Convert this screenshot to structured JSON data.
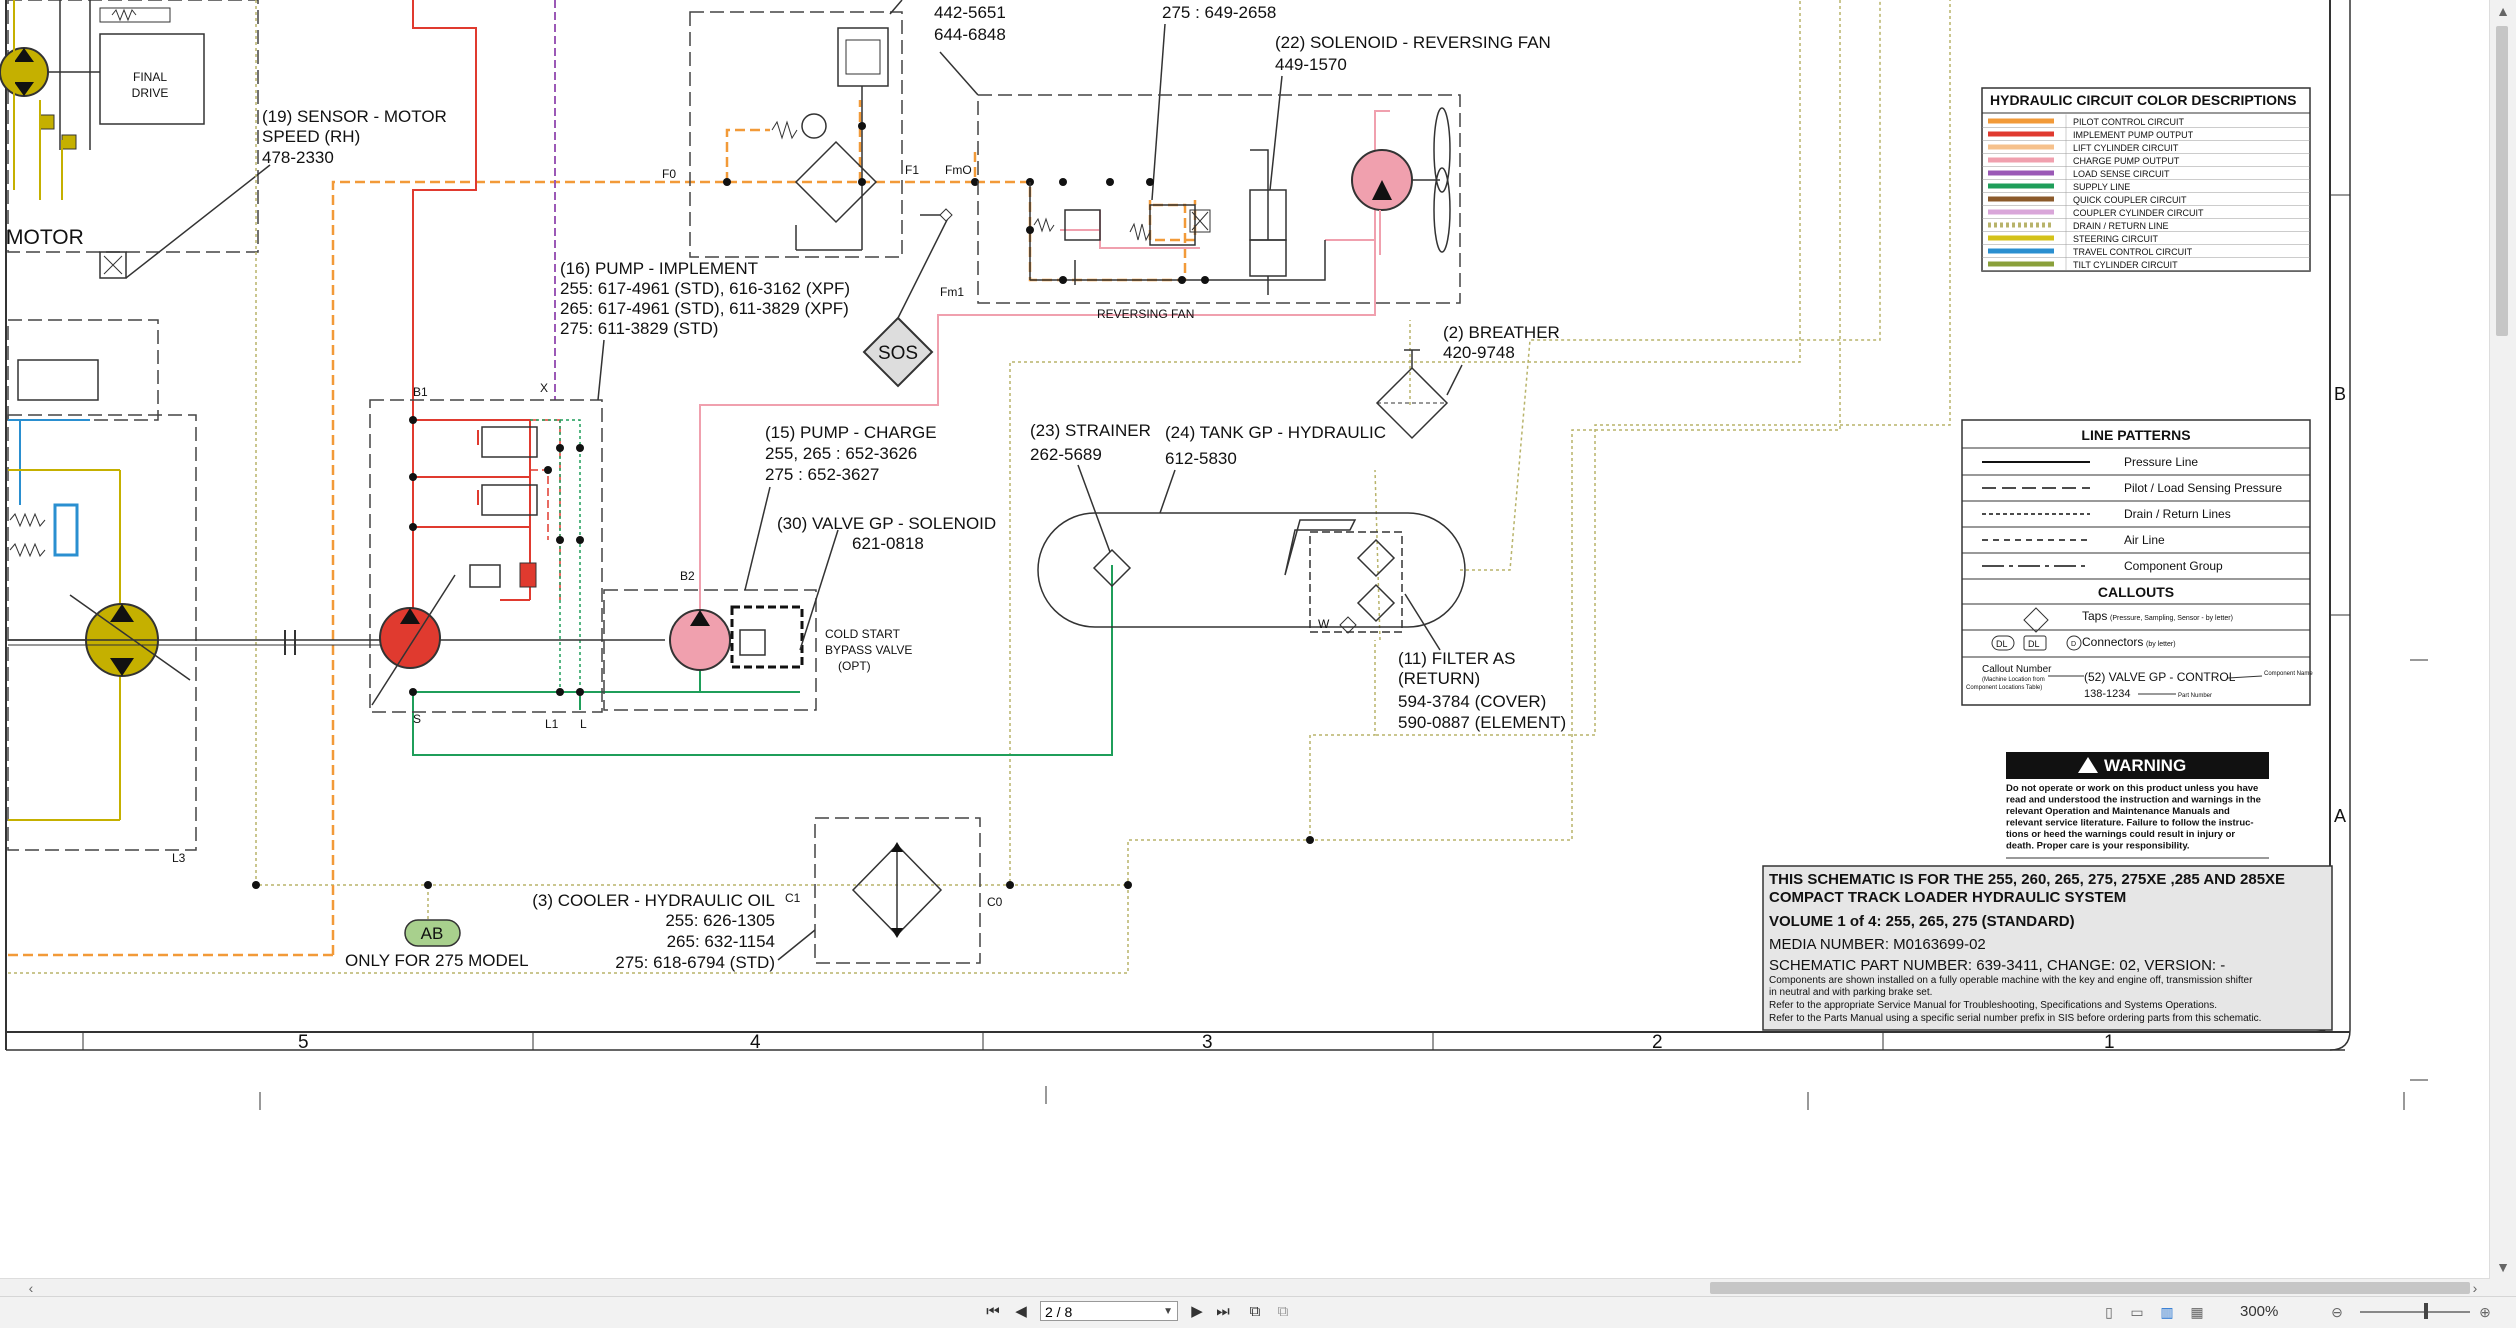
{
  "viewer": {
    "page_value": "2 / 8",
    "zoom": "300%"
  },
  "schematic": {
    "title_block": {
      "line1": "THIS SCHEMATIC IS FOR THE 255, 260, 265, 275, 275XE ,285 AND 285XE",
      "line2": "COMPACT TRACK LOADER HYDRAULIC SYSTEM",
      "volume": "VOLUME 1 of 4: 255, 265, 275 (STANDARD)",
      "media": "MEDIA NUMBER: M0163699-02",
      "part": "SCHEMATIC PART NUMBER: 639-3411, CHANGE: 02, VERSION: -",
      "note1": "Components are shown installed on a fully operable machine with the key and engine off, transmission shifter",
      "note2": "in neutral and with parking brake set.",
      "note3": "Refer to the appropriate Service Manual for Troubleshooting, Specifications and Systems Operations.",
      "note4": "Refer to the Parts Manual using a specific serial number prefix in SIS before ordering parts from this schematic."
    },
    "warning": {
      "title": "WARNING",
      "lines": [
        "Do not operate or work on this product unless you have",
        "read and understood the instruction and warnings in the",
        "relevant Operation and Maintenance Manuals and",
        "relevant service literature. Failure to follow the instruc-",
        "tions or heed the warnings could result in injury or",
        "death. Proper care is your responsibility."
      ]
    },
    "color_legend": {
      "title": "HYDRAULIC CIRCUIT COLOR DESCRIPTIONS",
      "items": [
        {
          "label": "PILOT CONTROL CIRCUIT",
          "color": "#f29a38",
          "pattern": "solid"
        },
        {
          "label": "IMPLEMENT PUMP OUTPUT",
          "color": "#e03a2f",
          "pattern": "solid"
        },
        {
          "label": "LIFT CYLINDER CIRCUIT",
          "color": "#f6c18c",
          "pattern": "solid"
        },
        {
          "label": "CHARGE PUMP OUTPUT",
          "color": "#f0a0ae",
          "pattern": "solid"
        },
        {
          "label": "LOAD SENSE CIRCUIT",
          "color": "#9b59b6",
          "pattern": "solid"
        },
        {
          "label": "SUPPLY LINE",
          "color": "#1f9e5a",
          "pattern": "solid"
        },
        {
          "label": "QUICK COUPLER CIRCUIT",
          "color": "#8b5a2b",
          "pattern": "solid"
        },
        {
          "label": "COUPLER CYLINDER CIRCUIT",
          "color": "#d9a6d9",
          "pattern": "solid"
        },
        {
          "label": "DRAIN / RETURN LINE",
          "color": "#b8b36a",
          "pattern": "dotted"
        },
        {
          "label": "STEERING CIRCUIT",
          "color": "#d4c21a",
          "pattern": "solid"
        },
        {
          "label": "TRAVEL CONTROL CIRCUIT",
          "color": "#2a8fd0",
          "pattern": "solid"
        },
        {
          "label": "TILT CYLINDER CIRCUIT",
          "color": "#8aa03b",
          "pattern": "solid"
        }
      ]
    },
    "line_patterns": {
      "title": "LINE PATTERNS",
      "items": [
        {
          "label": "Pressure Line",
          "dash": ""
        },
        {
          "label": "Pilot / Load Sensing Pressure",
          "dash": "14 6"
        },
        {
          "label": "Drain / Return Lines",
          "dash": "4 3"
        },
        {
          "label": "Air Line",
          "dash": "6 5"
        },
        {
          "label": "Component Group",
          "dash": "22 5 4 5"
        }
      ],
      "callouts_title": "CALLOUTS",
      "taps_label": "Taps",
      "taps_note": "(Pressure, Sampling, Sensor - by letter)",
      "connectors_label": "Connectors",
      "connectors_note": "(by letter)",
      "conn_dl": "DL",
      "conn_d": "D",
      "callout_number": "Callout Number",
      "callout_note1": "(Machine Location from",
      "callout_note2": "Component Locations Table)",
      "callout_example": "(52) VALVE GP - CONTROL",
      "callout_part": "138-1234",
      "part_number_label": "Part Number",
      "component_name_label": "Component Name"
    },
    "components": {
      "sensor": {
        "name": "(19) SENSOR - MOTOR",
        "sub": "SPEED (RH)",
        "part": "478-2330"
      },
      "final_drive": {
        "l1": "FINAL",
        "l2": "DRIVE"
      },
      "motor_label": "MOTOR",
      "pump_impl": {
        "name": "(16) PUMP - IMPLEMENT",
        "p1": "255: 617-4961 (STD), 616-3162 (XPF)",
        "p2": "265: 617-4961 (STD), 611-3829 (XPF)",
        "p3": "275: 611-3829 (STD)"
      },
      "pump_charge": {
        "name": "(15) PUMP - CHARGE",
        "p1": "255, 265 : 652-3626",
        "p2": "275 : 652-3627"
      },
      "valve_solenoid": {
        "name": "(30) VALVE GP - SOLENOID",
        "part": "621-0818"
      },
      "cold_start": {
        "l1": "COLD START",
        "l2": "BYPASS VALVE",
        "l3": "(OPT)"
      },
      "solenoid_fan": {
        "name": "(22) SOLENOID - REVERSING FAN",
        "part": "449-1570"
      },
      "top_parts": {
        "p1": "442-5651",
        "p2": "644-6848",
        "p3": "275 : 649-2658"
      },
      "reversing_fan": "REVERSING FAN",
      "breather": {
        "name": "(2) BREATHER",
        "part": "420-9748"
      },
      "strainer": {
        "name": "(23) STRAINER",
        "part": "262-5689"
      },
      "tank": {
        "name": "(24) TANK GP - HYDRAULIC",
        "part": "612-5830"
      },
      "filter": {
        "name": "(11) FILTER AS",
        "sub": "(RETURN)",
        "p1": "594-3784 (COVER)",
        "p2": "590-0887 (ELEMENT)"
      },
      "cooler": {
        "name": "(3) COOLER - HYDRAULIC OIL",
        "p1": "255: 626-1305",
        "p2": "265: 632-1154",
        "p3": "275: 618-6794 (STD)"
      },
      "ab_tag": "AB",
      "ab_note": "ONLY FOR 275 MODEL",
      "sos": "SOS"
    },
    "ports": {
      "f0": "F0",
      "f1": "F1",
      "fmo": "FmO",
      "fm1": "Fm1",
      "b1": "B1",
      "b2": "B2",
      "x": "X",
      "s": "S",
      "l1": "L1",
      "l": "L",
      "l3": "L3",
      "c1": "C1",
      "c0": "C0"
    },
    "zones": [
      "5",
      "4",
      "3",
      "2",
      "1"
    ],
    "row_marks": [
      "B",
      "A"
    ]
  }
}
